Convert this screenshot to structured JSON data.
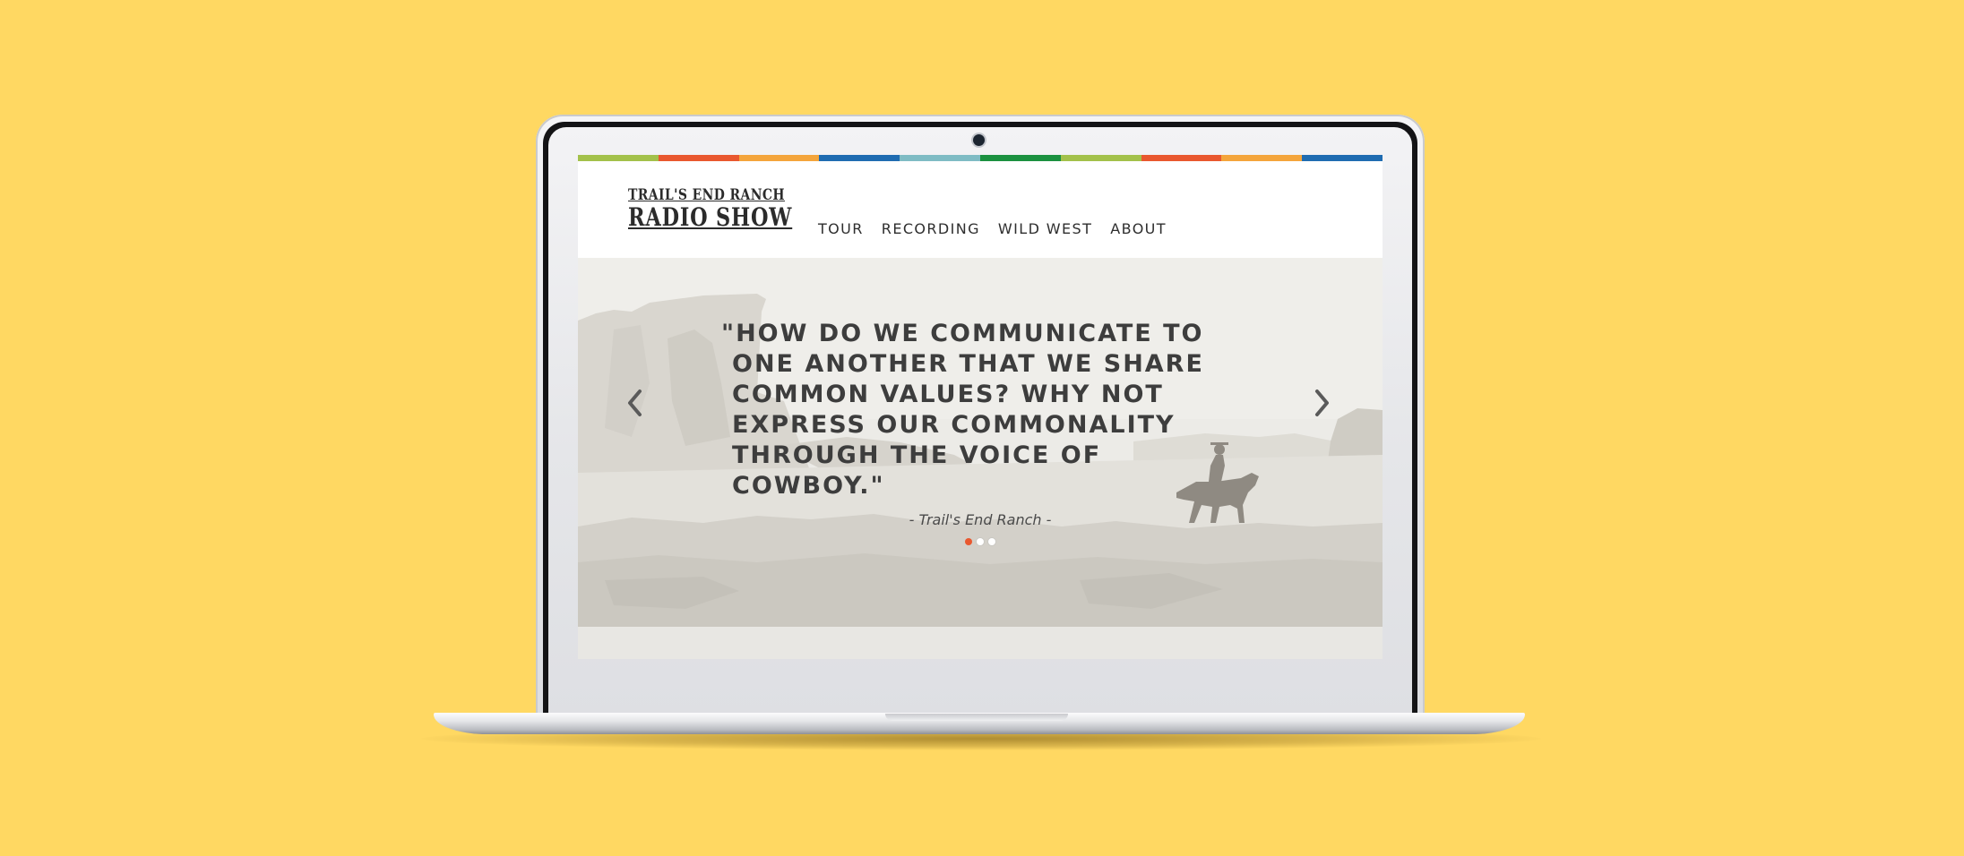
{
  "brand": {
    "line1": "TRAIL'S END RANCH",
    "line2": "RADIO SHOW"
  },
  "nav": {
    "items": [
      {
        "label": "TOUR"
      },
      {
        "label": "RECORDING"
      },
      {
        "label": "WILD WEST"
      },
      {
        "label": "ABOUT"
      }
    ]
  },
  "hero": {
    "quote": "\"HOW DO WE COMMUNICATE TO ONE ANOTHER THAT WE SHARE COMMON VALUES? WHY NOT EXPRESS OUR COMMONALITY THROUGH THE VOICE OF COWBOY.\"",
    "attribution": "- Trail's End Ranch -",
    "slide_count": 3,
    "active_slide": 1,
    "prev_icon": "chevron-left-icon",
    "next_icon": "chevron-right-icon",
    "background_image": "desert-mesa-cowboy-on-horse-photo"
  },
  "colors": {
    "page_background": "#ffd862",
    "stripe": [
      "#a3c14a",
      "#e9582f",
      "#f4a53b",
      "#1f6cb1",
      "#7fbcc4",
      "#1b9140",
      "#a3c14a",
      "#e9582f",
      "#f4a53b",
      "#1f6cb1"
    ],
    "active_dot": "#e9582f",
    "text": "#3d3d3d"
  }
}
